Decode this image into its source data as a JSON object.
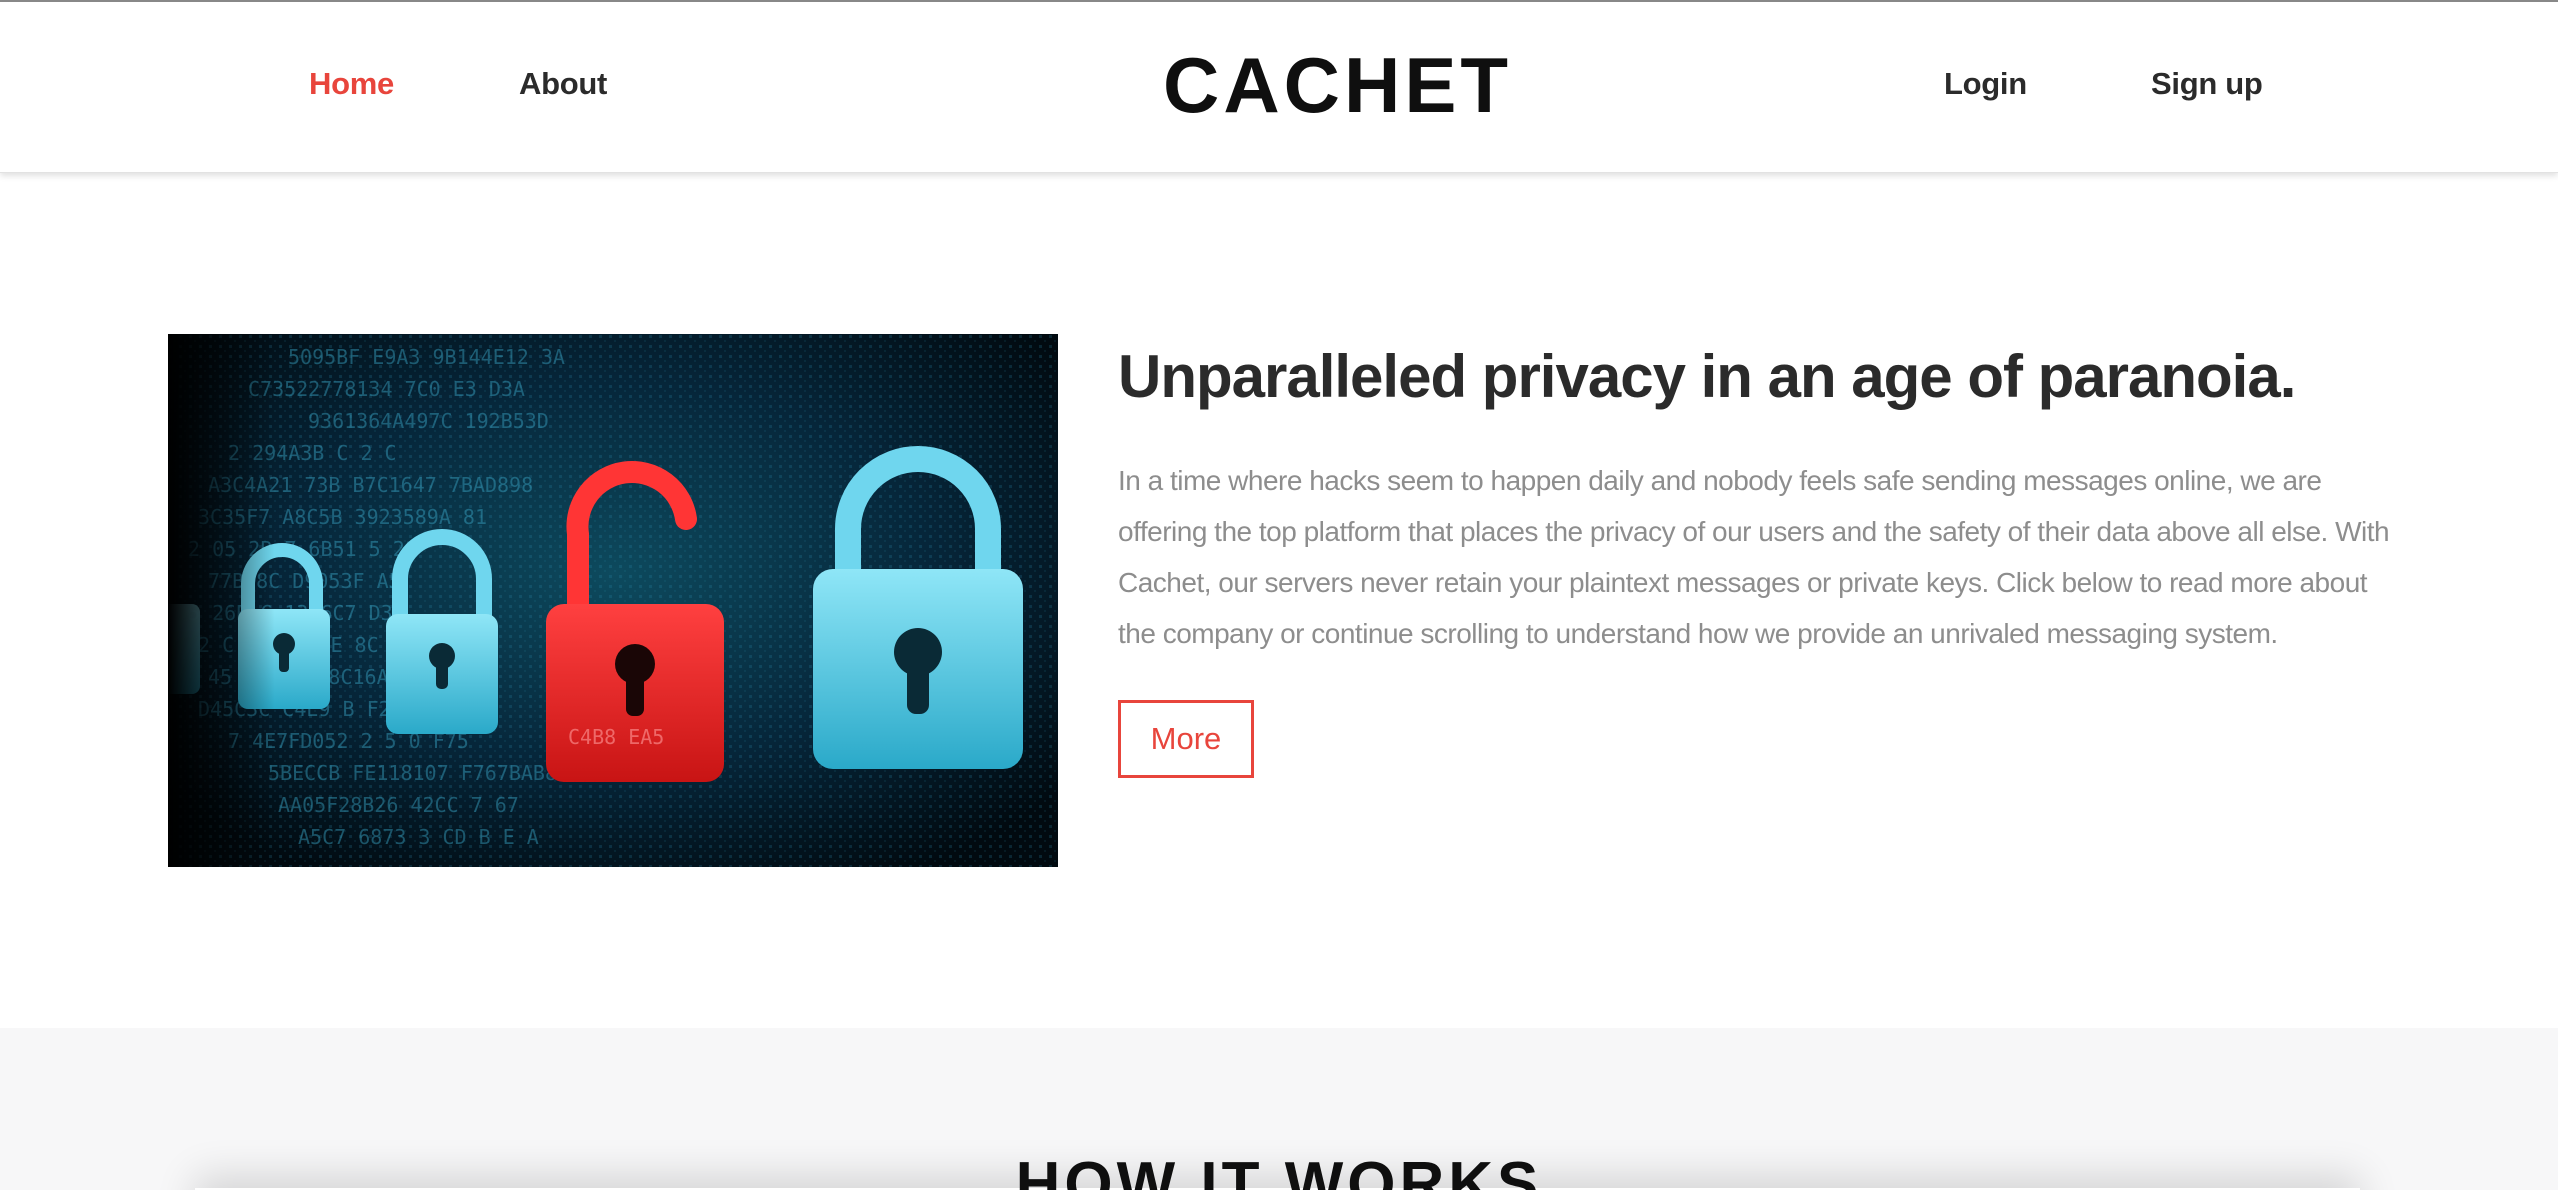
{
  "nav": {
    "home": "Home",
    "about": "About",
    "brand": "CACHET",
    "login": "Login",
    "signup": "Sign up"
  },
  "hero": {
    "image_alt": "padlock-icons-on-digital-code-background",
    "title": "Unparalleled privacy in an age of paranoia.",
    "body": "In a time where hacks seem to happen daily and nobody feels safe sending messages online, we are offering the top platform that places the privacy of our users and the safety of their data above all else. With Cachet, our servers never retain your plaintext messages or private keys. Click below to read more about the company or continue scrolling to understand how we provide an unrivaled messaging system.",
    "more_label": "More"
  },
  "how_it_works": {
    "title": "HOW IT WORKS"
  },
  "colors": {
    "accent": "#e8453c",
    "text_dark": "#2b2b2b",
    "text_muted": "#8d8d8d",
    "section_bg": "#f7f7f8",
    "lock_blue": "#5fd0ea",
    "lock_red": "#ff2b2b"
  }
}
